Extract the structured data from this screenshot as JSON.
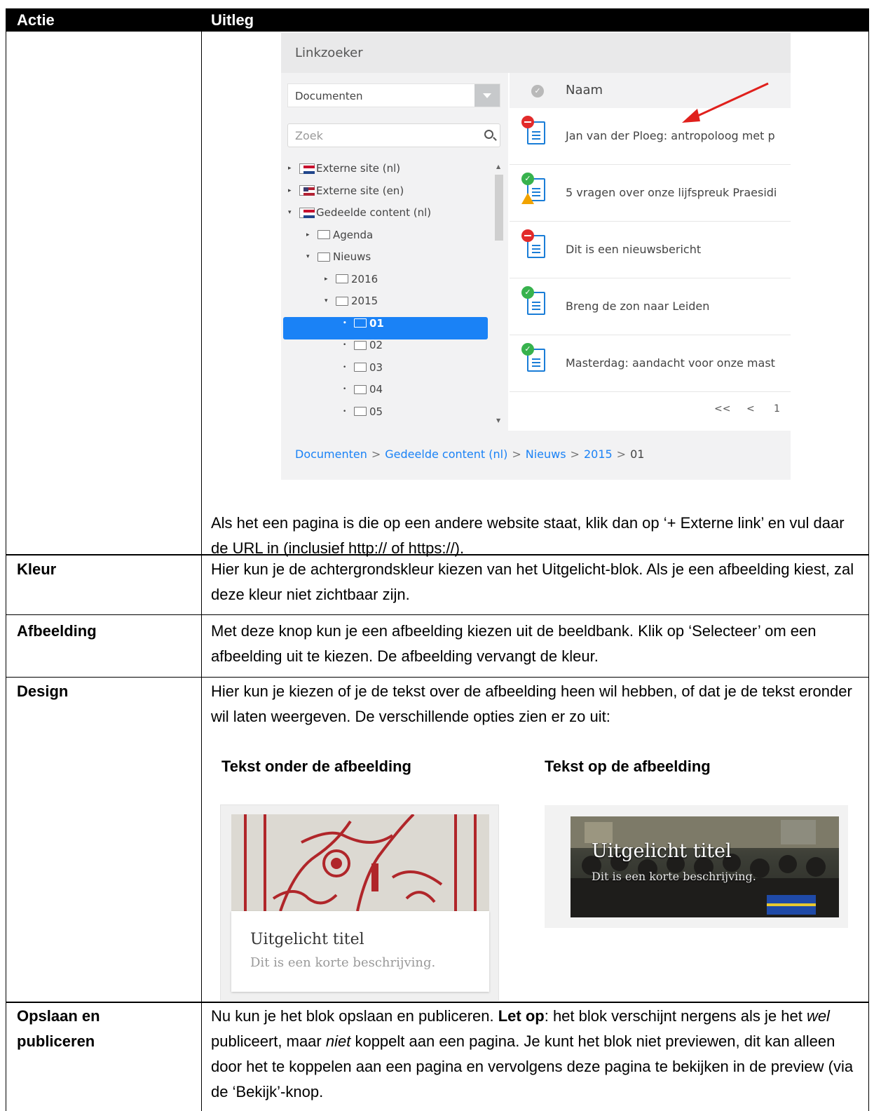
{
  "table": {
    "headers": {
      "actie": "Actie",
      "uitleg": "Uitleg"
    },
    "rows": {
      "link": {
        "text": "Als het een pagina is die op een andere website staat, klik dan op ‘+ Externe link’ en vul daar de URL in (inclusief http:// of https://)."
      },
      "kleur": {
        "label": "Kleur",
        "text": "Hier kun je de achtergrondskleur kiezen van het Uitgelicht-blok. Als je een afbeelding kiest, zal deze kleur niet zichtbaar zijn."
      },
      "afbeelding": {
        "label": "Afbeelding",
        "text": "Met deze knop kun je een afbeelding kiezen uit de beeldbank. Klik op ‘Selecteer’ om een afbeelding uit te kiezen. De afbeelding vervangt de kleur."
      },
      "design": {
        "label": "Design",
        "text": "Hier kun je kiezen of je de tekst over de afbeelding heen wil hebben, of dat je de tekst eronder wil laten weergeven. De verschillende opties zien er zo uit:",
        "option1_title": "Tekst onder de afbeelding",
        "option2_title": "Tekst op de afbeelding"
      },
      "publish": {
        "label_line1": "Opslaan en",
        "label_line2": "publiceren",
        "text_part1": "Nu kun je het blok opslaan en publiceren. ",
        "text_bold": "Let op",
        "text_part2": ": het blok verschijnt nergens als je het ",
        "text_em1": "wel",
        "text_part3": " publiceert, maar ",
        "text_em2": "niet",
        "text_part4": " koppelt aan een pagina. Je kunt het blok niet previewen, dit kan alleen door het te koppelen aan een pagina en vervolgens deze pagina te bekijken in de preview (via de ‘Bekijk’-knop."
      }
    }
  },
  "linkzoeker": {
    "title": "Linkzoeker",
    "dropdown_value": "Documenten",
    "search_placeholder": "Zoek",
    "column_name": "Naam",
    "tree": [
      {
        "label": "Externe site (nl)",
        "toggle": "▸",
        "icon": "flag-nl-icon"
      },
      {
        "label": "Externe site (en)",
        "toggle": "▸",
        "icon": "flag-us-icon"
      },
      {
        "label": "Gedeelde content (nl)",
        "toggle": "▾",
        "icon": "flag-nl-open-icon"
      },
      {
        "label": "Agenda",
        "toggle": "▸",
        "icon": "folder-icon"
      },
      {
        "label": "Nieuws",
        "toggle": "▾",
        "icon": "folder-open-icon"
      },
      {
        "label": "2016",
        "toggle": "▸",
        "icon": "folder-icon"
      },
      {
        "label": "2015",
        "toggle": "▾",
        "icon": "folder-open-icon"
      },
      {
        "label": "01",
        "toggle": "•",
        "icon": "folder-open-icon",
        "selected": true
      },
      {
        "label": "02",
        "toggle": "•",
        "icon": "folder-icon"
      },
      {
        "label": "03",
        "toggle": "•",
        "icon": "folder-icon"
      },
      {
        "label": "04",
        "toggle": "•",
        "icon": "folder-icon"
      },
      {
        "label": "05",
        "toggle": "•",
        "icon": "folder-icon"
      }
    ],
    "documents": [
      {
        "name": "Jan van der Ploeg: antropoloog met p",
        "status": "unpublished"
      },
      {
        "name": "5 vragen over onze lijfspreuk Praesidi",
        "status": "published-warning"
      },
      {
        "name": "Dit is een nieuwsbericht",
        "status": "unpublished"
      },
      {
        "name": "Breng de zon naar Leiden",
        "status": "published"
      },
      {
        "name": "Masterdag: aandacht voor onze mast",
        "status": "published"
      }
    ],
    "pager": {
      "first": "<<",
      "prev": "<",
      "page": "1"
    },
    "breadcrumb": {
      "items": [
        "Documenten",
        "Gedeelde content (nl)",
        "Nieuws",
        "2015"
      ],
      "current": "01",
      "separator": ">"
    },
    "colors": {
      "accent": "#1a82f6",
      "arrow": "#e0201c"
    }
  },
  "design_examples": {
    "below": {
      "title": "Uitgelicht titel",
      "description": "Dit is een korte beschrijving."
    },
    "overlay": {
      "title": "Uitgelicht titel",
      "description": "Dit is een korte beschrijving."
    }
  }
}
